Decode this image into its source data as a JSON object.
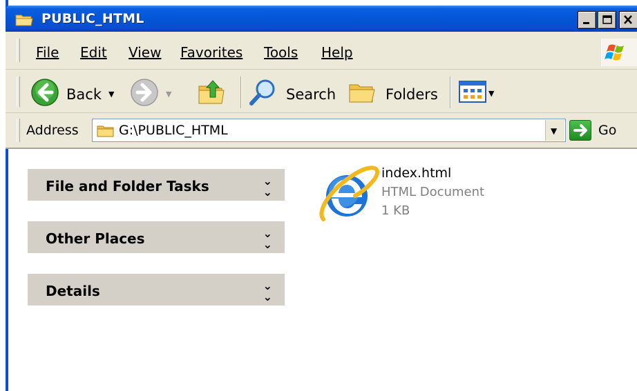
{
  "window": {
    "title": "PUBLIC_HTML"
  },
  "menu": {
    "items": [
      "File",
      "Edit",
      "View",
      "Favorites",
      "Tools",
      "Help"
    ]
  },
  "toolbar": {
    "back_label": "Back",
    "search_label": "Search",
    "folders_label": "Folders"
  },
  "address": {
    "label": "Address",
    "value": "G:\\PUBLIC_HTML",
    "go_label": "Go"
  },
  "tasks": {
    "items": [
      "File and Folder Tasks",
      "Other Places",
      "Details"
    ]
  },
  "files": [
    {
      "name": "index.html",
      "type": "HTML Document",
      "size": "1 KB",
      "icon": "ie-icon"
    }
  ],
  "colors": {
    "titlebar": "#0356d6",
    "chrome": "#ece9d8",
    "task_panel": "#d4d0c8"
  }
}
